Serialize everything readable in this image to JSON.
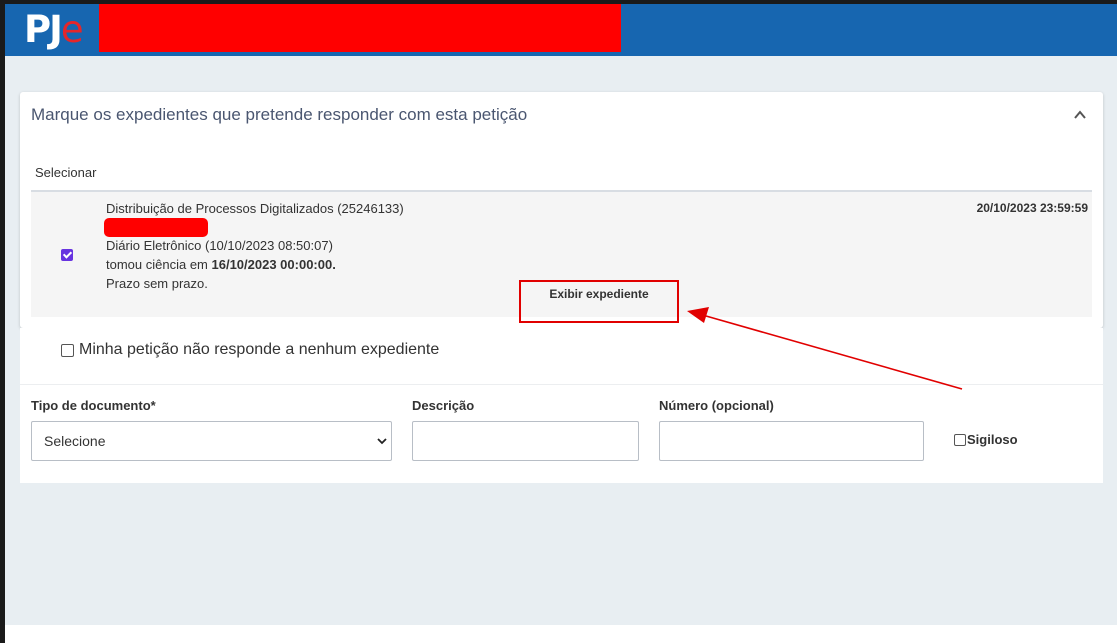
{
  "header": {
    "logo_main": "PJ",
    "logo_accent": "e"
  },
  "card": {
    "title": "Marque os expedientes que pretende responder com esta petição",
    "select_header": "Selecionar",
    "row": {
      "line1": "Distribuição de Processos Digitalizados (25246133)",
      "line2": "Diário Eletrônico (10/10/2023 08:50:07)",
      "line3_prefix": "tomou ciência em ",
      "line3_bold": "16/10/2023 00:00:00.",
      "line4": "Prazo sem prazo.",
      "deadline": "20/10/2023 23:59:59",
      "checked": true,
      "button_label": "Exibir expediente"
    }
  },
  "form": {
    "no_response_label": "Minha petição não responde a nenhum expediente",
    "tipo_label": "Tipo de documento*",
    "tipo_value": "Selecione",
    "descricao_label": "Descrição",
    "numero_label": "Número (opcional)",
    "sigiloso_label": "Sigiloso"
  },
  "colors": {
    "header_blue": "#1766b0",
    "logo_red": "#e5262a",
    "checkbox_purple": "#6733e0",
    "annotation_red": "#e10000"
  }
}
